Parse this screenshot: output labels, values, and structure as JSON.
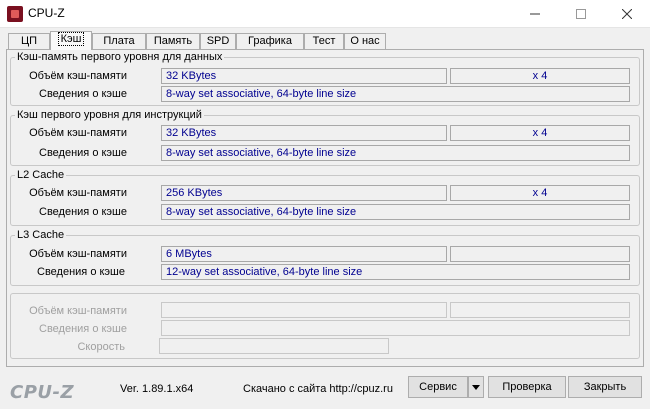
{
  "window": {
    "title": "CPU-Z",
    "controls": {
      "minimize": "minimize-icon",
      "maximize": "maximize-icon",
      "close": "close-icon"
    }
  },
  "tabs": [
    "ЦП",
    "Кэш",
    "Плата",
    "Память",
    "SPD",
    "Графика",
    "Тест",
    "О нас"
  ],
  "active_tab": "Кэш",
  "groups": [
    {
      "title": "Кэш-память первого уровня для данных",
      "size_label": "Объём кэш-памяти",
      "size_value": "32 KBytes",
      "multiplier": "x 4",
      "desc_label": "Сведения о кэше",
      "desc_value": "8-way set associative, 64-byte line size"
    },
    {
      "title": "Кэш первого уровня для инструкций",
      "size_label": "Объём кэш-памяти",
      "size_value": "32 KBytes",
      "multiplier": "x 4",
      "desc_label": "Сведения о кэше",
      "desc_value": "8-way set associative, 64-byte line size"
    },
    {
      "title": "L2 Cache",
      "size_label": "Объём кэш-памяти",
      "size_value": "256 KBytes",
      "multiplier": "x 4",
      "desc_label": "Сведения о кэше",
      "desc_value": "8-way set associative, 64-byte line size"
    },
    {
      "title": "L3 Cache",
      "size_label": "Объём кэш-памяти",
      "size_value": "6 MBytes",
      "multiplier": "",
      "desc_label": "Сведения о кэше",
      "desc_value": "12-way set associative, 64-byte line size"
    }
  ],
  "disabled_group": {
    "size_label": "Объём кэш-памяти",
    "desc_label": "Сведения о кэше",
    "speed_label": "Скорость"
  },
  "footer": {
    "brand": "CPU-Z",
    "version": "Ver. 1.89.1.x64",
    "download": "Скачано с сайта http://cpuz.ru",
    "service_button": "Сервис",
    "check_button": "Проверка",
    "close_button": "Закрыть"
  },
  "colors": {
    "value_text": "#000090",
    "brand_text": "#9aa0a6",
    "app_icon": "#7a1020"
  }
}
